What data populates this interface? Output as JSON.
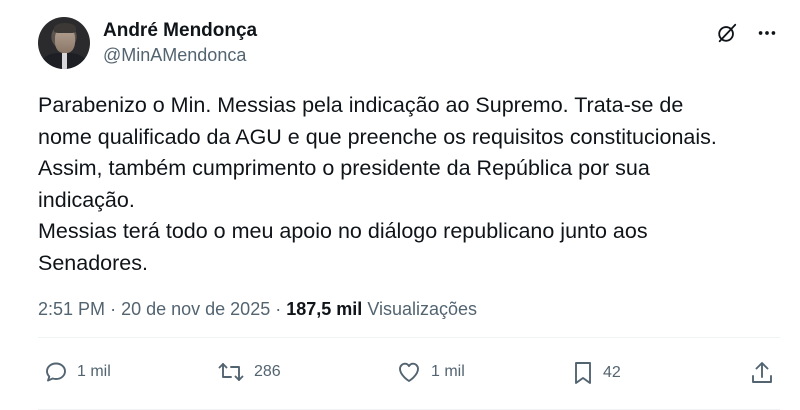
{
  "author": {
    "display_name": "André Mendonça",
    "handle": "@MinAMendonca"
  },
  "tweet": {
    "lines": [
      "Parabenizo o Min. Messias pela indicação ao Supremo. Trata-se de",
      "nome qualificado da AGU e que preenche os requisitos constitucionais.",
      "Assim, também cumprimento o presidente da República por sua",
      "indicação.",
      "Messias terá todo o meu apoio no diálogo republicano junto aos",
      "Senadores."
    ]
  },
  "meta": {
    "time": "2:51 PM",
    "separator": "·",
    "date": "20 de nov de 2025",
    "views_count": "187,5 mil",
    "views_label": "Visualizações"
  },
  "actions": {
    "replies": "1 mil",
    "reposts": "286",
    "likes": "1 mil",
    "bookmarks": "42"
  },
  "icons": {
    "grok": "grok-icon",
    "more": "more-icon",
    "reply": "reply-icon",
    "repost": "repost-icon",
    "like": "like-icon",
    "bookmark": "bookmark-icon",
    "share": "share-icon"
  },
  "colors": {
    "text": "#0f1419",
    "secondary": "#536471",
    "divider": "#eff3f4"
  }
}
